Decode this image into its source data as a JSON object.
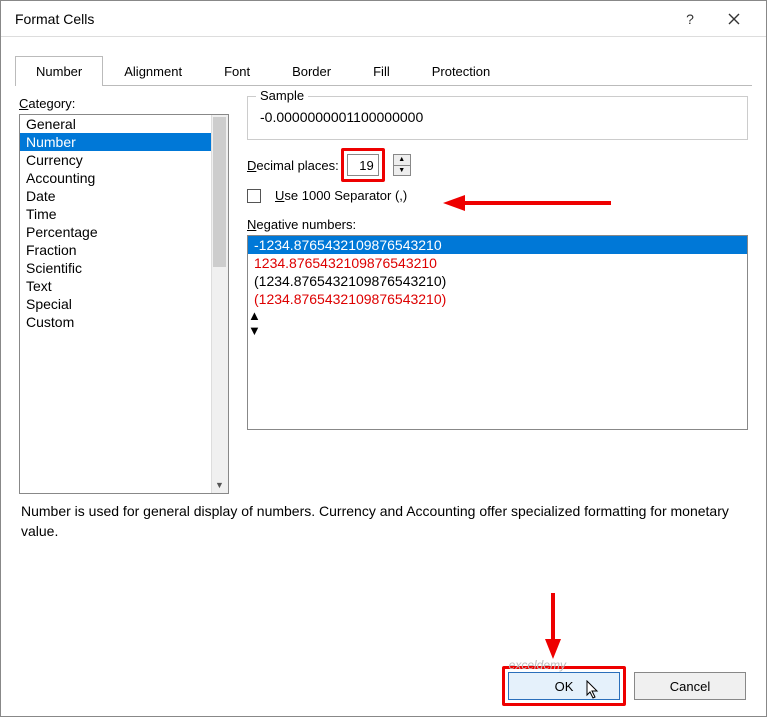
{
  "window": {
    "title": "Format Cells"
  },
  "tabs": [
    "Number",
    "Alignment",
    "Font",
    "Border",
    "Fill",
    "Protection"
  ],
  "active_tab": "Number",
  "category": {
    "label": "Category:",
    "items": [
      "General",
      "Number",
      "Currency",
      "Accounting",
      "Date",
      "Time",
      "Percentage",
      "Fraction",
      "Scientific",
      "Text",
      "Special",
      "Custom"
    ],
    "selected": "Number"
  },
  "sample": {
    "label": "Sample",
    "value": "-0.0000000001100000000"
  },
  "decimal": {
    "label": "Decimal places:",
    "value": "19"
  },
  "separator": {
    "label": "Use 1000 Separator (,)",
    "checked": false
  },
  "negative": {
    "label": "Negative numbers:",
    "items": [
      {
        "text": "-1234.8765432109876543210",
        "style": "sel"
      },
      {
        "text": "1234.8765432109876543210",
        "style": "red"
      },
      {
        "text": "(1234.8765432109876543210)",
        "style": ""
      },
      {
        "text": "(1234.8765432109876543210)",
        "style": "red"
      }
    ]
  },
  "description": "Number is used for general display of numbers.  Currency and Accounting offer specialized formatting for monetary value.",
  "buttons": {
    "ok": "OK",
    "cancel": "Cancel"
  },
  "watermark": "exceldemy"
}
